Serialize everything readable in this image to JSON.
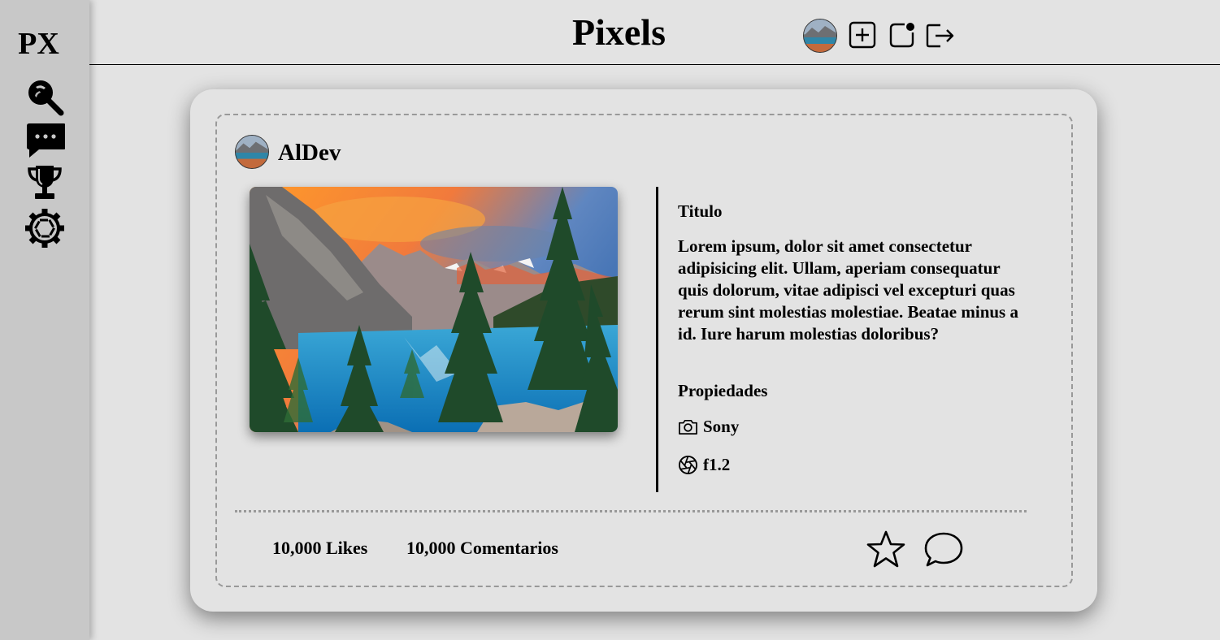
{
  "sidebar": {
    "logo": "PX",
    "icons": [
      "search-icon",
      "chat-icon",
      "trophy-icon",
      "settings-icon"
    ]
  },
  "header": {
    "title": "Pixels",
    "icons": [
      "avatar",
      "add-icon",
      "notifications-icon",
      "logout-icon"
    ]
  },
  "post": {
    "author": "AlDev",
    "title": "Titulo",
    "description": "Lorem ipsum, dolor sit amet consectetur adipisicing elit. Ullam, aperiam consequatur quis dolorum, vitae adipisci vel excepturi quas rerum sint molestias molestiae. Beatae minus a id. Iure harum molestias doloribus?",
    "properties_label": "Propiedades",
    "camera": "Sony",
    "aperture": "f1.2",
    "likes": "10,000 Likes",
    "comments": "10,000 Comentarios",
    "action_icons": [
      "star-icon",
      "comment-icon"
    ]
  }
}
